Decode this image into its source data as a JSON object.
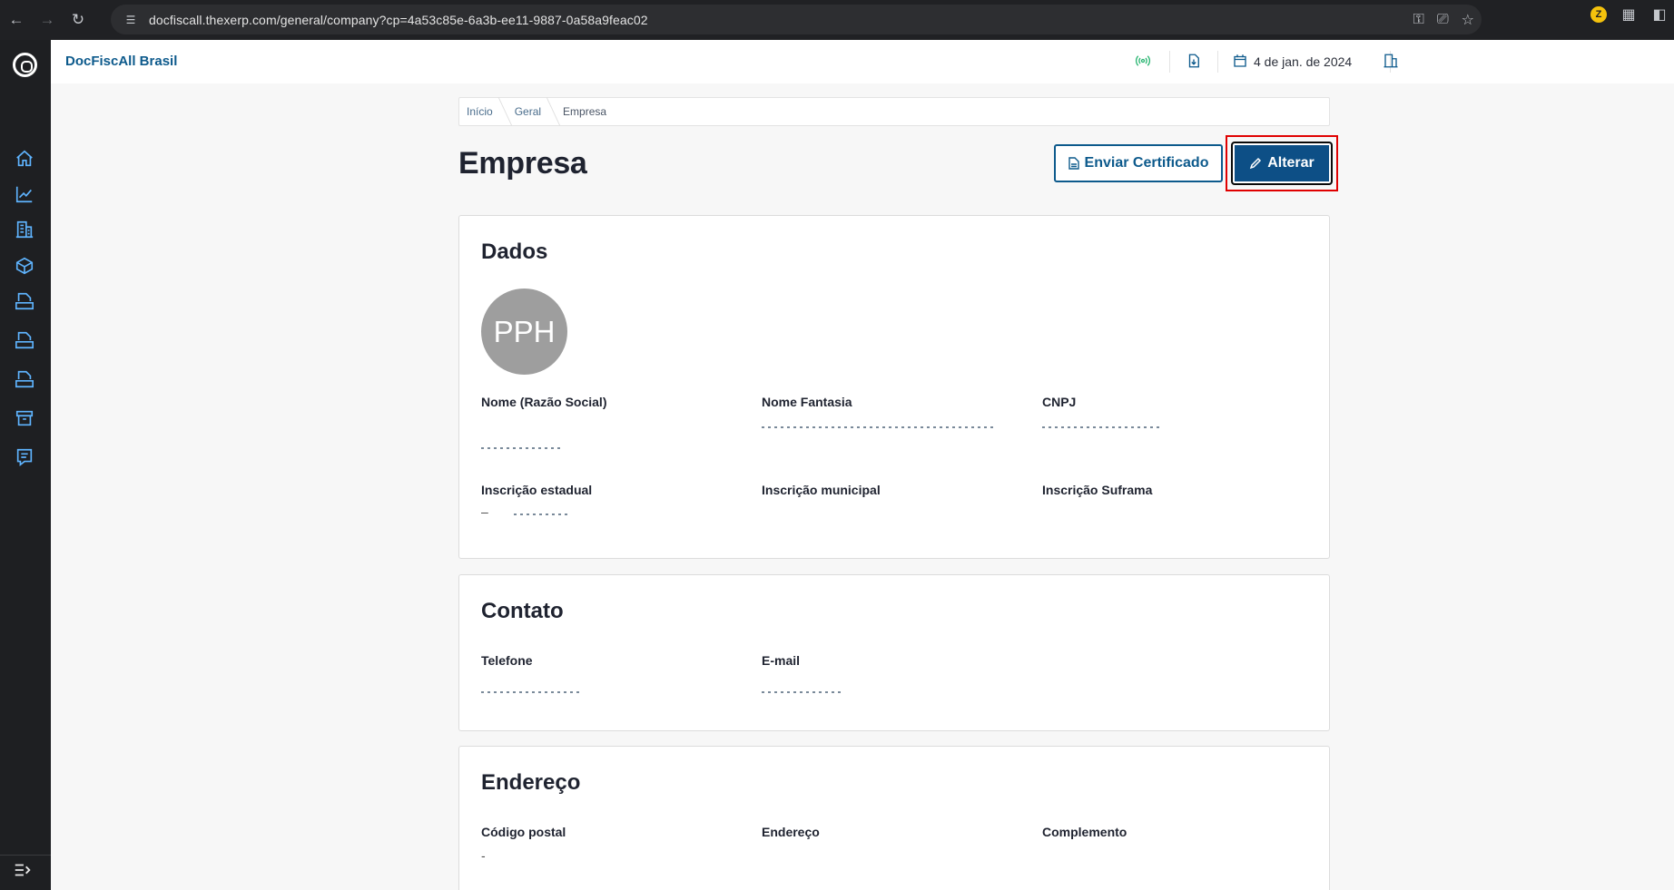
{
  "browser": {
    "url": "docfiscall.thexerp.com/general/company?cp=4a53c85e-6a3b-ee11-9887-0a58a9feac02",
    "back_icon": "arrow-left-icon",
    "forward_icon": "arrow-right-icon",
    "reload_icon": "reload-icon",
    "extension_badge": "Z"
  },
  "sidebar": {
    "items": [
      {
        "name": "home",
        "icon": "home-icon"
      },
      {
        "name": "dashboard",
        "icon": "chart-icon"
      },
      {
        "name": "company",
        "icon": "building-icon"
      },
      {
        "name": "products",
        "icon": "box-icon"
      },
      {
        "name": "nfse",
        "icon": "nfse-icon"
      },
      {
        "name": "nfce",
        "icon": "nfce-icon"
      },
      {
        "name": "nfe",
        "icon": "nfe-icon"
      },
      {
        "name": "archive",
        "icon": "archive-icon"
      },
      {
        "name": "receipts",
        "icon": "receipt-icon"
      }
    ]
  },
  "header": {
    "app_title": "DocFiscAll Brasil",
    "date": "4 de jan. de 2024"
  },
  "breadcrumb": {
    "items": [
      "Início",
      "Geral",
      "Empresa"
    ]
  },
  "page": {
    "title": "Empresa",
    "send_certificate_label": "Enviar Certificado",
    "edit_label": "Alterar"
  },
  "dados": {
    "title": "Dados",
    "avatar_initials": "PPH",
    "labels": {
      "nome": "Nome (Razão Social)",
      "fantasia": "Nome Fantasia",
      "cnpj": "CNPJ",
      "ie": "Inscrição estadual",
      "im": "Inscrição municipal",
      "suframa": "Inscrição Suframa"
    },
    "values": {
      "ie": "–"
    }
  },
  "contato": {
    "title": "Contato",
    "labels": {
      "telefone": "Telefone",
      "email": "E-mail"
    }
  },
  "endereco": {
    "title": "Endereço",
    "labels": {
      "cep": "Código postal",
      "endereco": "Endereço",
      "complemento": "Complemento"
    },
    "values": {
      "cep": "-"
    }
  }
}
